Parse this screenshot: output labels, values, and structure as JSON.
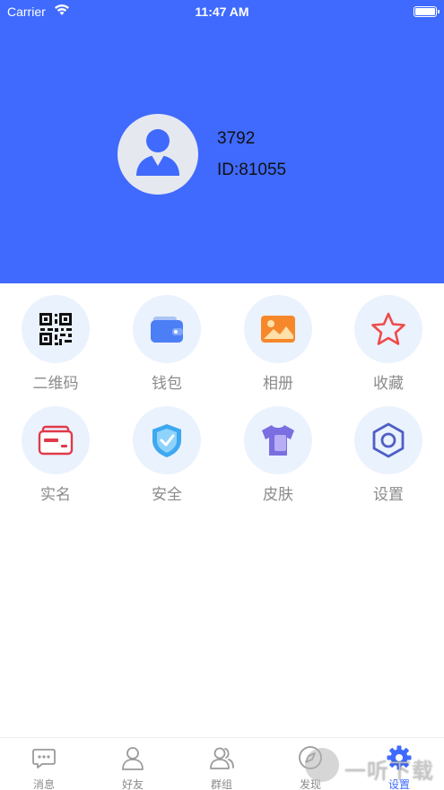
{
  "status_bar": {
    "carrier": "Carrier",
    "time": "11:47 AM"
  },
  "profile": {
    "username": "3792",
    "user_id": "ID:81055"
  },
  "grid": [
    {
      "label": "二维码",
      "icon": "qr-code-icon"
    },
    {
      "label": "钱包",
      "icon": "wallet-icon"
    },
    {
      "label": "相册",
      "icon": "photo-album-icon"
    },
    {
      "label": "收藏",
      "icon": "star-icon"
    },
    {
      "label": "实名",
      "icon": "id-card-icon"
    },
    {
      "label": "安全",
      "icon": "shield-icon"
    },
    {
      "label": "皮肤",
      "icon": "tshirt-icon"
    },
    {
      "label": "设置",
      "icon": "hex-nut-icon"
    }
  ],
  "tabs": [
    {
      "label": "消息",
      "icon": "chat-bubble-icon"
    },
    {
      "label": "好友",
      "icon": "person-icon"
    },
    {
      "label": "群组",
      "icon": "group-icon"
    },
    {
      "label": "发现",
      "icon": "compass-icon"
    },
    {
      "label": "设置",
      "icon": "gear-icon",
      "active": true
    }
  ],
  "watermark": {
    "text": "一听下载"
  },
  "colors": {
    "header": "#3f6afd",
    "active_tab": "#3f6afd",
    "label_gray": "#8b8b8b"
  }
}
